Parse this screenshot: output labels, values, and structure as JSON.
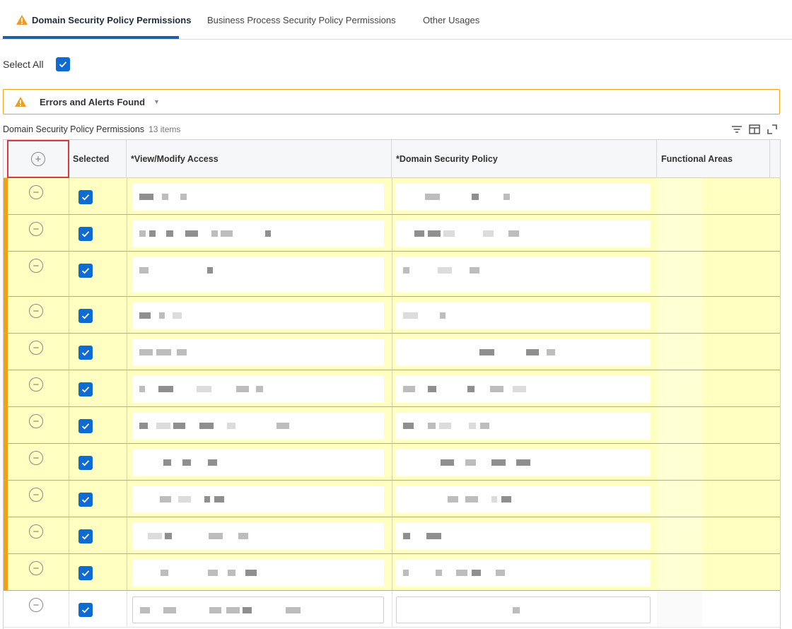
{
  "tabs": [
    {
      "label": "Domain Security Policy Permissions",
      "active": true,
      "warning": true
    },
    {
      "label": "Business Process Security Policy Permissions",
      "active": false
    },
    {
      "label": "Other Usages",
      "active": false
    }
  ],
  "select_all": {
    "label": "Select All",
    "checked": true
  },
  "alert": {
    "label": "Errors and Alerts Found",
    "icon": "warning-icon",
    "color": "#f0a41e"
  },
  "grid": {
    "title": "Domain Security Policy Permissions",
    "count": "13 items",
    "tools": [
      "filter-icon",
      "columns-icon",
      "fullscreen-icon"
    ],
    "columns": [
      "Selected",
      "*View/Modify Access",
      "*Domain Security Policy",
      "Functional Areas"
    ],
    "row_flag_color": "#ffffc2",
    "accent_color": "#0e6bd1"
  }
}
